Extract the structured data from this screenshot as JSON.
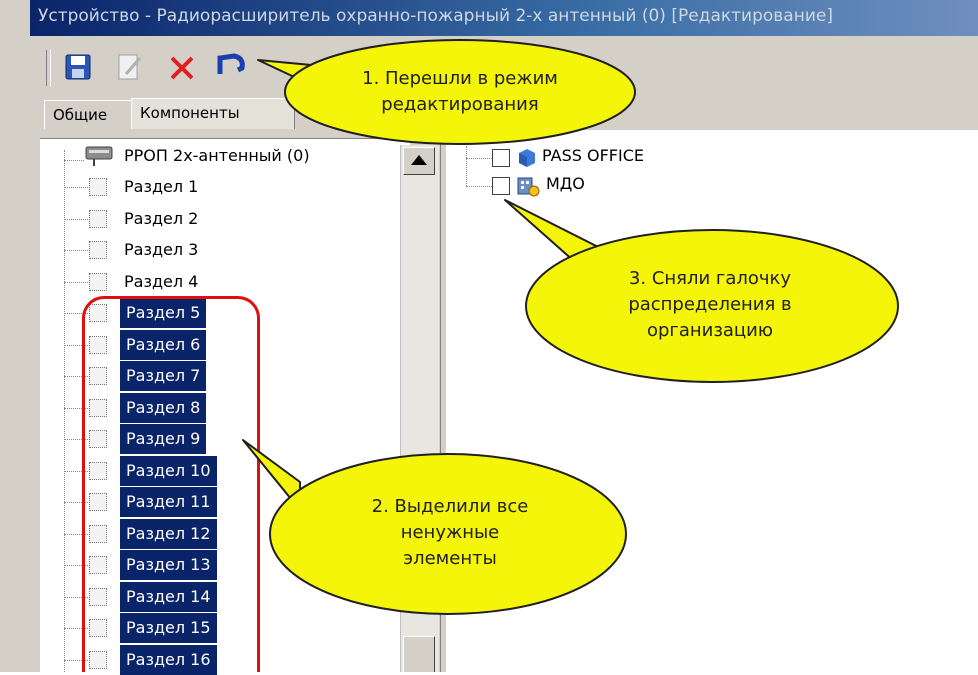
{
  "window": {
    "title": "Устройство - Радиорасширитель охранно-пожарный 2-х антенный (0) [Редактирование]"
  },
  "toolbar": {
    "icons": [
      "save-icon",
      "edit-icon",
      "delete-icon",
      "undo-icon"
    ]
  },
  "tabs": [
    {
      "label": "Общие"
    },
    {
      "label": "Компоненты"
    }
  ],
  "tree": {
    "root": "РРОП 2х-антенный (0)",
    "items": [
      {
        "label": "Раздел 1",
        "selected": false
      },
      {
        "label": "Раздел 2",
        "selected": false
      },
      {
        "label": "Раздел 3",
        "selected": false
      },
      {
        "label": "Раздел 4",
        "selected": false
      },
      {
        "label": "Раздел 5",
        "selected": true
      },
      {
        "label": "Раздел 6",
        "selected": true
      },
      {
        "label": "Раздел 7",
        "selected": true
      },
      {
        "label": "Раздел 8",
        "selected": true
      },
      {
        "label": "Раздел 9",
        "selected": true
      },
      {
        "label": "Раздел 10",
        "selected": true
      },
      {
        "label": "Раздел 11",
        "selected": true
      },
      {
        "label": "Раздел 12",
        "selected": true
      },
      {
        "label": "Раздел 13",
        "selected": true
      },
      {
        "label": "Раздел 14",
        "selected": true
      },
      {
        "label": "Раздел 15",
        "selected": true
      },
      {
        "label": "Раздел 16",
        "selected": true
      }
    ]
  },
  "organizations": [
    {
      "label": "PASS OFFICE",
      "checked": false
    },
    {
      "label": "МДО",
      "checked": false
    }
  ],
  "callouts": {
    "c1": {
      "line1": "1. Перешли в режим",
      "line2": "редактирования"
    },
    "c2": {
      "line1": "2. Выделили все",
      "line2": "ненужные",
      "line3": "элементы"
    },
    "c3": {
      "line1": "3. Сняли галочку",
      "line2": "распределения в",
      "line3": "организацию"
    }
  },
  "colors": {
    "callout_fill": "#f5f50a",
    "selection": "#0a246a",
    "highlight_border": "#e01010"
  }
}
